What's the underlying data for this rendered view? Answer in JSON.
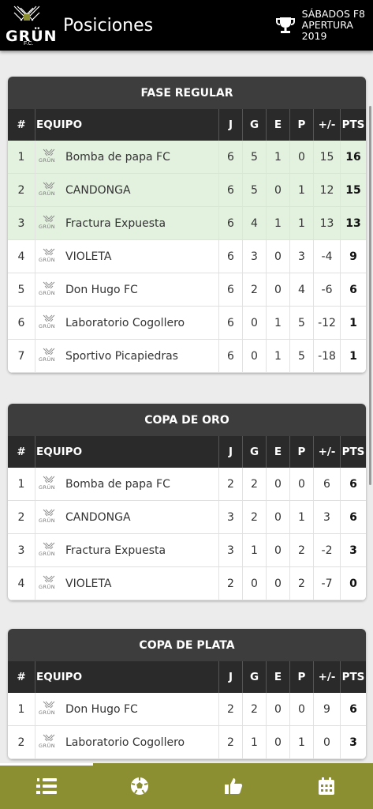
{
  "header": {
    "logo_text": "GRÜN",
    "logo_sub": "F.C.",
    "title": "Posiciones",
    "league_line1": "SÁBADOS F8",
    "league_line2": "APERTURA",
    "league_line3": "2019"
  },
  "columns": {
    "pos": "#",
    "team": "EQUIPO",
    "j": "J",
    "g": "G",
    "e": "E",
    "p": "P",
    "diff": "+/-",
    "pts": "PTS"
  },
  "team_logo_text": "GRÜN",
  "tables": [
    {
      "title": "FASE REGULAR",
      "rows": [
        {
          "pos": "1",
          "team": "Bomba de papa FC",
          "j": "6",
          "g": "5",
          "e": "1",
          "p": "0",
          "diff": "15",
          "pts": "16",
          "highlight": true
        },
        {
          "pos": "2",
          "team": "CANDONGA",
          "j": "6",
          "g": "5",
          "e": "0",
          "p": "1",
          "diff": "12",
          "pts": "15",
          "highlight": true
        },
        {
          "pos": "3",
          "team": "Fractura Expuesta",
          "j": "6",
          "g": "4",
          "e": "1",
          "p": "1",
          "diff": "13",
          "pts": "13",
          "highlight": true
        },
        {
          "pos": "4",
          "team": "VIOLETA",
          "j": "6",
          "g": "3",
          "e": "0",
          "p": "3",
          "diff": "-4",
          "pts": "9",
          "highlight": false
        },
        {
          "pos": "5",
          "team": "Don Hugo FC",
          "j": "6",
          "g": "2",
          "e": "0",
          "p": "4",
          "diff": "-6",
          "pts": "6",
          "highlight": false
        },
        {
          "pos": "6",
          "team": "Laboratorio Cogollero",
          "j": "6",
          "g": "0",
          "e": "1",
          "p": "5",
          "diff": "-12",
          "pts": "1",
          "highlight": false
        },
        {
          "pos": "7",
          "team": "Sportivo Picapiedras",
          "j": "6",
          "g": "0",
          "e": "1",
          "p": "5",
          "diff": "-18",
          "pts": "1",
          "highlight": false
        }
      ]
    },
    {
      "title": "COPA DE ORO",
      "rows": [
        {
          "pos": "1",
          "team": "Bomba de papa FC",
          "j": "2",
          "g": "2",
          "e": "0",
          "p": "0",
          "diff": "6",
          "pts": "6",
          "highlight": false
        },
        {
          "pos": "2",
          "team": "CANDONGA",
          "j": "3",
          "g": "2",
          "e": "0",
          "p": "1",
          "diff": "3",
          "pts": "6",
          "highlight": false
        },
        {
          "pos": "3",
          "team": "Fractura Expuesta",
          "j": "3",
          "g": "1",
          "e": "0",
          "p": "2",
          "diff": "-2",
          "pts": "3",
          "highlight": false
        },
        {
          "pos": "4",
          "team": "VIOLETA",
          "j": "2",
          "g": "0",
          "e": "0",
          "p": "2",
          "diff": "-7",
          "pts": "0",
          "highlight": false
        }
      ]
    },
    {
      "title": "COPA DE PLATA",
      "rows": [
        {
          "pos": "1",
          "team": "Don Hugo FC",
          "j": "2",
          "g": "2",
          "e": "0",
          "p": "0",
          "diff": "9",
          "pts": "6",
          "highlight": false
        },
        {
          "pos": "2",
          "team": "Laboratorio Cogollero",
          "j": "2",
          "g": "1",
          "e": "0",
          "p": "1",
          "diff": "0",
          "pts": "3",
          "highlight": false
        }
      ]
    }
  ],
  "nav": {
    "tabs": [
      {
        "icon": "standings-list-icon",
        "active": true
      },
      {
        "icon": "soccer-ball-icon",
        "active": false
      },
      {
        "icon": "thumbs-up-icon",
        "active": false
      },
      {
        "icon": "calendar-icon",
        "active": false
      }
    ]
  },
  "colors": {
    "appbar": "#000000",
    "card_title": "#3d3d3d",
    "table_head": "#2a2a2a",
    "highlight_row": "#e3f1df",
    "bottom_nav": "#8b8f32"
  }
}
